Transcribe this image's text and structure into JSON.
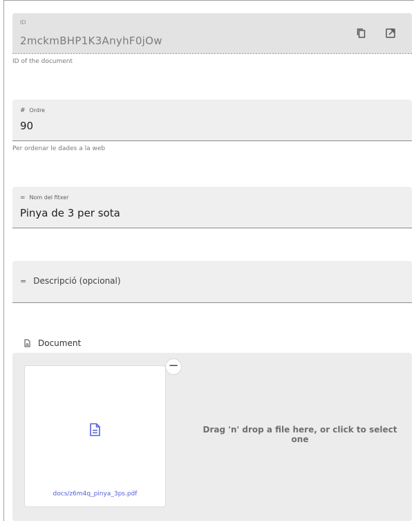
{
  "id_field": {
    "label": "ID",
    "value": "2mckmBHP1K3AnyhF0jOw",
    "helper": "ID of the document"
  },
  "ordre_field": {
    "icon": "#",
    "label": "Ordre",
    "value": "90",
    "helper": "Per ordenar le dades a la web"
  },
  "nom_field": {
    "icon": "=",
    "label": "Nom del fitxer",
    "value": "Pinya de 3 per sota"
  },
  "desc_field": {
    "icon": "=",
    "label": "Descripció (opcional)"
  },
  "document": {
    "label": "Document",
    "file_name": "docs/z6m4q_pinya_3ps.pdf",
    "remove_symbol": "−",
    "dropzone_hint": "Drag 'n' drop a file here, or click to select one"
  },
  "colors": {
    "accent": "#5560d8",
    "field_bg": "#efefef",
    "readonly_bg": "#e3e3e3"
  }
}
